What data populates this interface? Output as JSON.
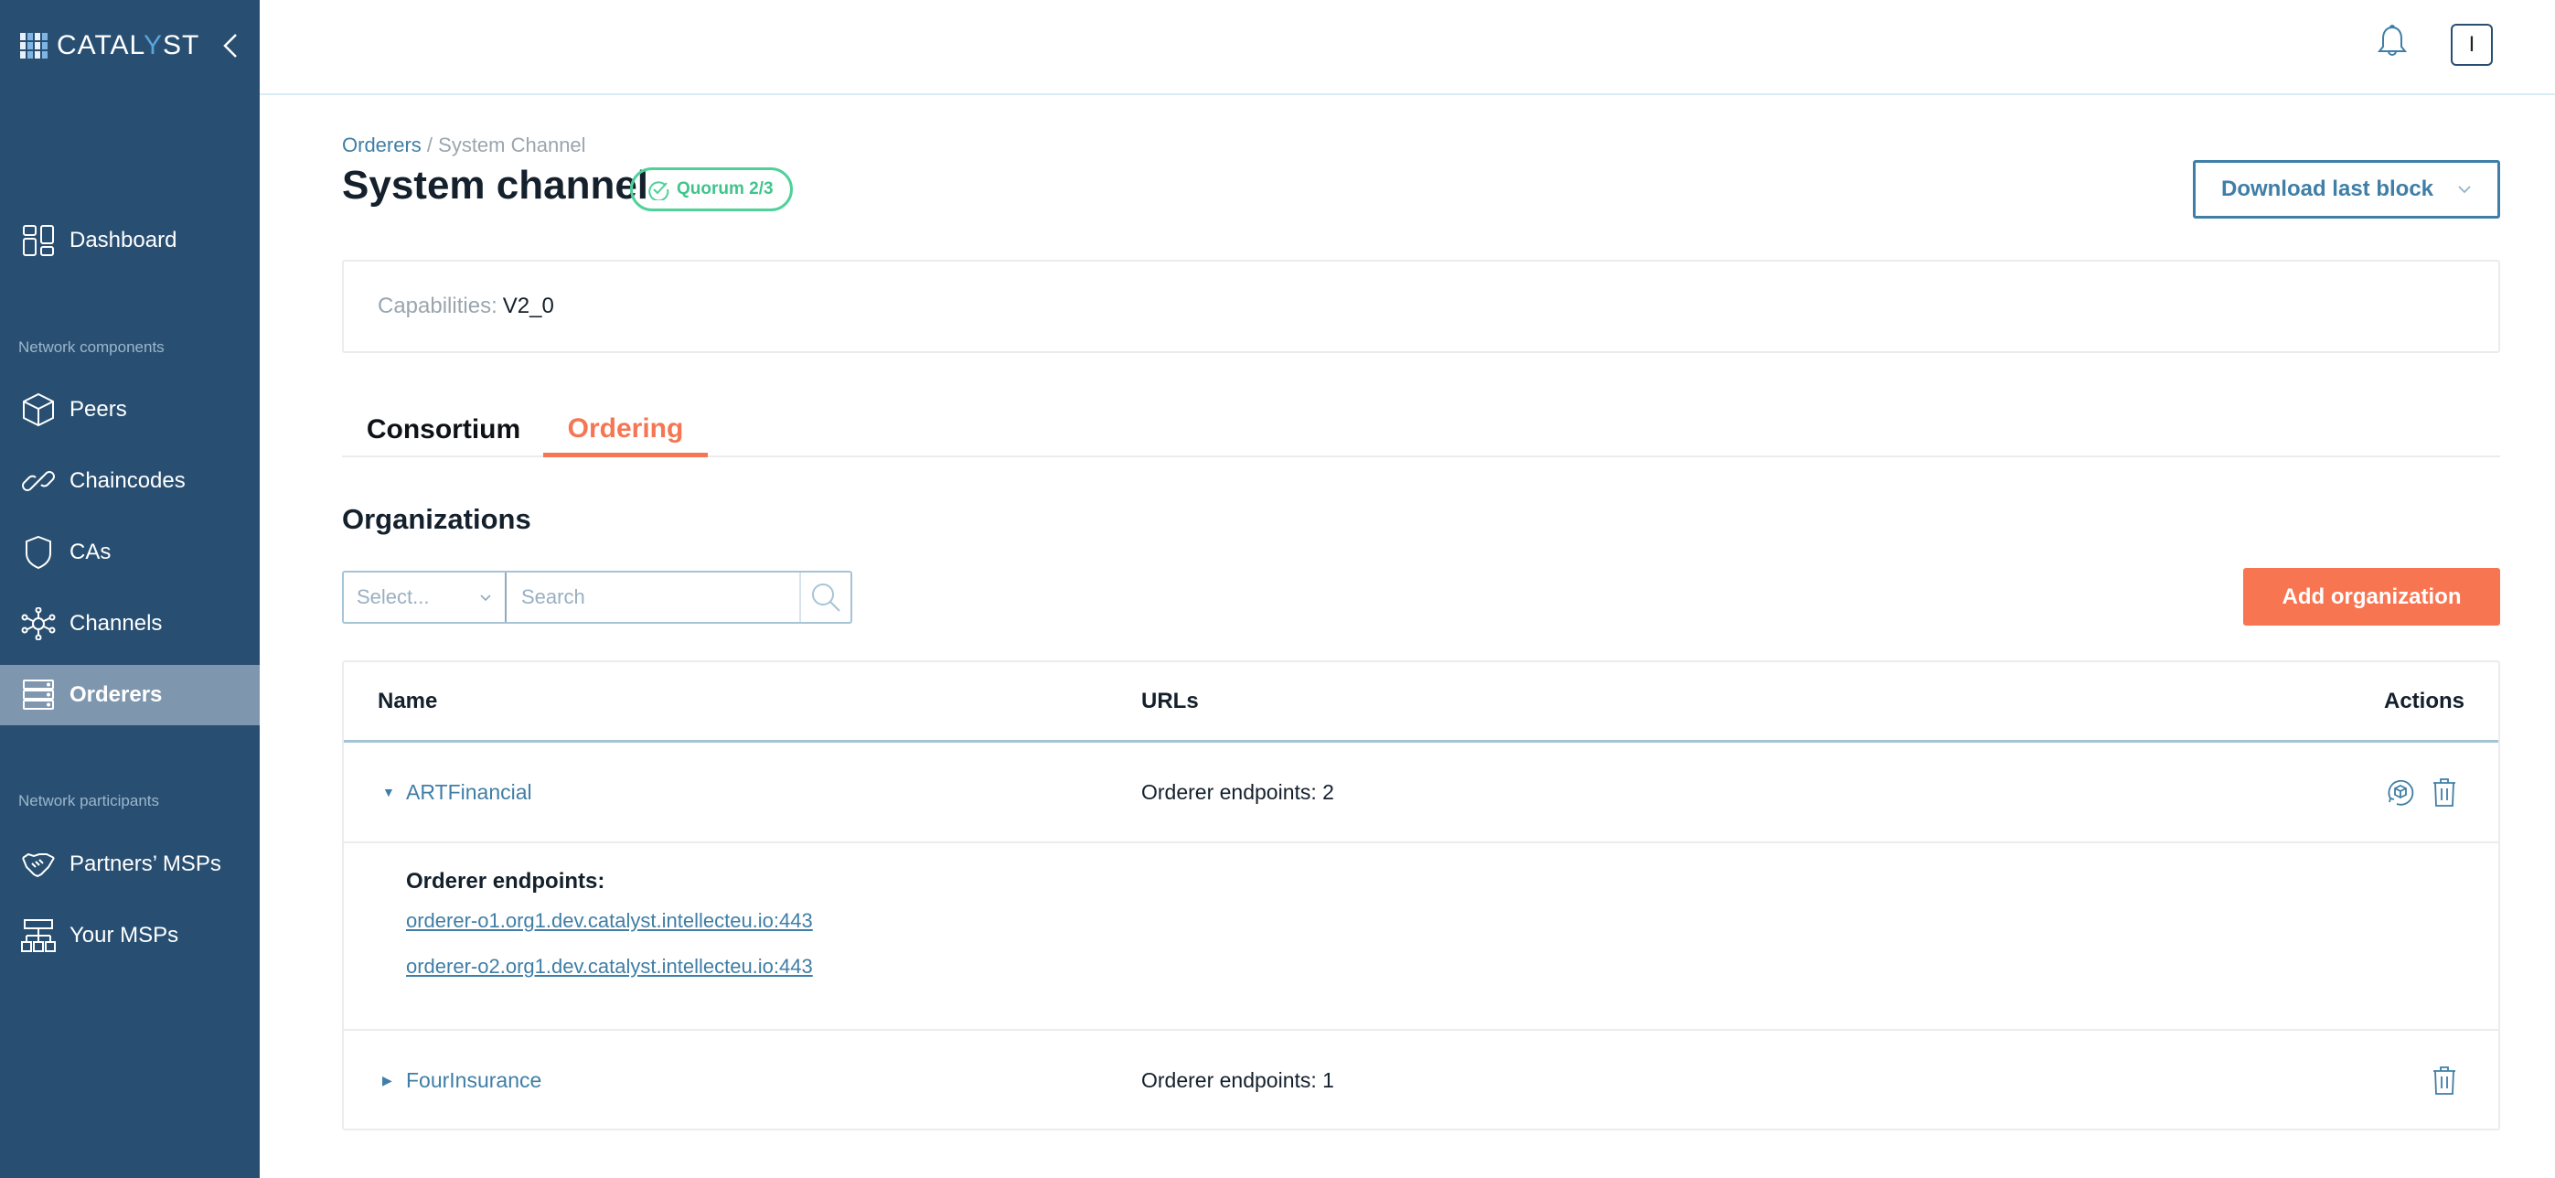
{
  "app": {
    "logo_text_pre": "CATAL",
    "logo_text_y": "Y",
    "logo_text_post": "ST"
  },
  "sidebar": {
    "collapse_icon": "chevron-left-icon",
    "sections": {
      "components": "Network components",
      "participants": "Network participants"
    },
    "items": [
      {
        "label": "Dashboard",
        "icon": "dashboard-icon",
        "active": false
      },
      {
        "label": "Peers",
        "icon": "cube-icon",
        "active": false
      },
      {
        "label": "Chaincodes",
        "icon": "link-icon",
        "active": false
      },
      {
        "label": "CAs",
        "icon": "shield-icon",
        "active": false
      },
      {
        "label": "Channels",
        "icon": "network-icon",
        "active": false
      },
      {
        "label": "Orderers",
        "icon": "server-icon",
        "active": true
      },
      {
        "label": "Partners’ MSPs",
        "icon": "handshake-icon",
        "active": false
      },
      {
        "label": "Your MSPs",
        "icon": "org-chart-icon",
        "active": false
      }
    ]
  },
  "header": {
    "bell_icon": "bell-icon",
    "avatar_initial": "I"
  },
  "breadcrumb": {
    "parent": "Orderers",
    "separator": " / ",
    "current": "System Channel"
  },
  "page": {
    "title": "System channel",
    "quorum_badge": "Quorum 2/3",
    "download_button": "Download last block"
  },
  "capabilities": {
    "label": "Capabilities:",
    "value": "V2_0"
  },
  "tabs": [
    {
      "label": "Consortium",
      "active": false
    },
    {
      "label": "Ordering",
      "active": true
    }
  ],
  "organizations": {
    "title": "Organizations",
    "filter_select_placeholder": "Select...",
    "search_placeholder": "Search",
    "add_button": "Add organization",
    "columns": {
      "name": "Name",
      "urls": "URLs",
      "actions": "Actions"
    },
    "rows": [
      {
        "name": "ARTFinancial",
        "urls": "Orderer endpoints: 2",
        "expanded": true,
        "endpoints_title": "Orderer endpoints:",
        "endpoints": [
          "orderer-o1.org1.dev.catalyst.intellecteu.io:443",
          "orderer-o2.org1.dev.catalyst.intellecteu.io:443"
        ]
      },
      {
        "name": "FourInsurance",
        "urls": "Orderer endpoints: 1",
        "expanded": false
      }
    ]
  },
  "colors": {
    "sidebar_bg": "#284f72",
    "sidebar_active": "#7f97ae",
    "accent_orange": "#f87552",
    "link_blue": "#3f7ea6",
    "quorum_green": "#4fd19a"
  }
}
